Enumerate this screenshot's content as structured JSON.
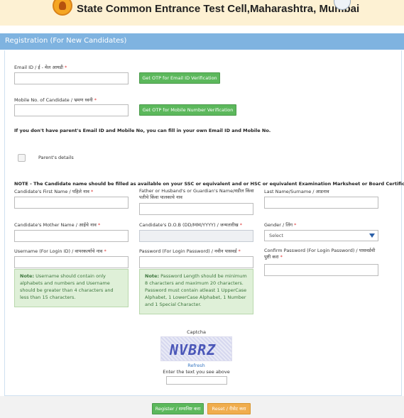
{
  "header": {
    "title": "State Common Entrance Test Cell,Maharashtra, Mumbai"
  },
  "panel": {
    "title": "Registration (For New Candidates)"
  },
  "email": {
    "label": "Email ID / ई - मेल आयडी",
    "required_mark": "*",
    "value": "",
    "otp_button": "Get OTP for Email ID Verification"
  },
  "mobile": {
    "label": "Mobile No. of Candidate / भ्रमण ध्वनी",
    "required_mark": "*",
    "value": "",
    "otp_button": "Get OTP for Mobile Number Verification"
  },
  "parents_note": "If you don't have parent's Email ID and Mobile No, you can fill in your own Email ID and Mobile No.",
  "parents_checkbox": {
    "label": "Parent's details",
    "checked": false
  },
  "name_note": "NOTE - The Candidate name should be filled as available on your SSC or equivalent and or HSC or equivalent Examination Marksheet or Board Certificate.",
  "first_name": {
    "label": "Candidate's First Name / पहिले नाव",
    "required_mark": "*",
    "value": ""
  },
  "father_name": {
    "label": "Father or Husband's or Guardian's Name/वडील किंवा पतीचे किंवा पालकाचे नाव",
    "value": ""
  },
  "last_name": {
    "label": "Last Name/Surname / आडनाव",
    "value": ""
  },
  "mother_name": {
    "label": "Candidate's Mother Name / आईचे नाव",
    "required_mark": "*",
    "value": ""
  },
  "dob": {
    "label": "Candidate's D.O.B (DD/MM/YYYY) / जन्मतारीख",
    "required_mark": "*",
    "value": ""
  },
  "gender": {
    "label": "Gender / लिंग",
    "required_mark": "*",
    "selected": "Select"
  },
  "username": {
    "label": "Username (For Login ID) / वापरकर्त्याचे नाव",
    "required_mark": "*",
    "value": ""
  },
  "password": {
    "label": "Password (For Login Password) / नवीन पासवर्ड",
    "required_mark": "*",
    "value": ""
  },
  "confirm_password": {
    "label": "Confirm Password (For Login Password) / पासवर्डची पुष्टी करा",
    "required_mark": "*",
    "value": ""
  },
  "username_note": {
    "prefix": "Note:",
    "text": "Username should contain only alphabets and numbers and Username should be greater than 4 characters and less than 15 characters."
  },
  "password_note": {
    "prefix": "Note:",
    "text": "Password Length should be minimum 8 characters and maximum 20 characters. Password must contain atleast 1 UpperCase Alphabet, 1 LowerCase Alphabet, 1 Number and 1 Special Character."
  },
  "captcha": {
    "title": "Captcha",
    "image_text": "NVBRZ",
    "refresh": "Refresh",
    "instruction": "Enter the text you see above",
    "value": ""
  },
  "footer": {
    "register_button": "Register / समाविष्ट करा",
    "reset_button": "Reset / रीसेट करा"
  },
  "colors": {
    "header_bg": "#fdf1d3",
    "panel_head_bg": "#7fb3e0",
    "green_button": "#5cb85c",
    "orange_button": "#f0ad4e",
    "note_bg": "#dff0d8"
  }
}
